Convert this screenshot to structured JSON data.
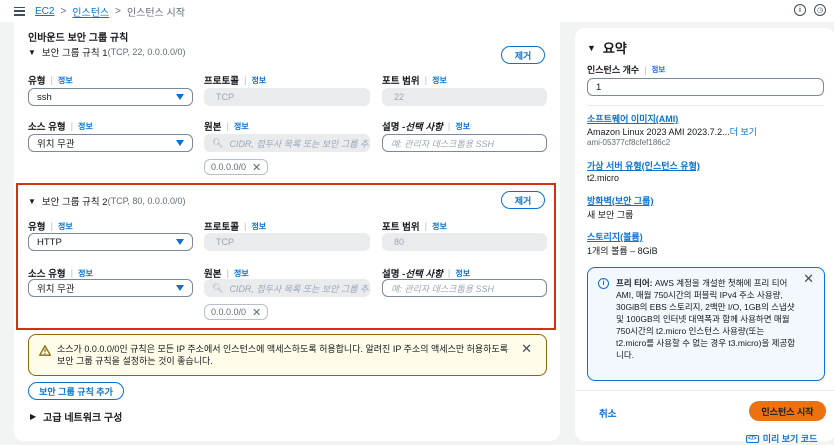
{
  "breadcrumb": {
    "root": "EC2",
    "level2": "인스턴스",
    "current": "인스턴스 시작"
  },
  "inbound": {
    "title": "인바운드 보안 그룹 규칙",
    "rule1": {
      "header": "보안 그룹 규칙 1",
      "detail": "(TCP, 22, 0.0.0.0/0)",
      "remove": "제거",
      "type_label": "유형",
      "type_value": "ssh",
      "protocol_label": "프로토콜",
      "protocol_value": "TCP",
      "port_label": "포트 범위",
      "port_value": "22",
      "source_type_label": "소스 유형",
      "source_type_value": "위치 무관",
      "source_label": "원본",
      "source_placeholder": "CIDR, 접두사 목록 또는 보안 그룹 추가",
      "desc_label": "설명 - ",
      "desc_label_em": "선택 사항",
      "desc_placeholder": "예: 관리자 데스크톱용 SSH",
      "token": "0.0.0.0/0"
    },
    "rule2": {
      "header": "보안 그룹 규칙 2",
      "detail": "(TCP, 80, 0.0.0.0/0)",
      "remove": "제거",
      "type_label": "유형",
      "type_value": "HTTP",
      "protocol_label": "프로토콜",
      "protocol_value": "TCP",
      "port_label": "포트 범위",
      "port_value": "80",
      "source_type_label": "소스 유형",
      "source_type_value": "위치 무관",
      "source_label": "원본",
      "source_placeholder": "CIDR, 접두사 목록 또는 보안 그룹 추가",
      "desc_label": "설명 - ",
      "desc_label_em": "선택 사항",
      "desc_placeholder": "예: 관리자 데스크톱용 SSH",
      "token": "0.0.0.0/0"
    },
    "info_word": "정보",
    "warning": "소스가 0.0.0.0/0인 규칙은 모든 IP 주소에서 인스턴스에 액세스하도록 허용합니다. 알려진 IP 주소의 액세스만 허용하도록 보안 그룹 규칙을 설정하는 것이 좋습니다.",
    "add_rule": "보안 그룹 규칙 추가",
    "advanced": "고급 네트워크 구성"
  },
  "summary": {
    "title": "요약",
    "count_label": "인스턴스 개수",
    "count_value": "1",
    "ami_label": "소프트웨어 이미지(AMI)",
    "ami_value": "Amazon Linux 2023 AMI 2023.7.2...",
    "ami_more": "더 보기",
    "ami_id": "ami-05377cf8cfef186c2",
    "type_label": "가상 서버 유형(인스턴스 유형)",
    "type_value": "t2.micro",
    "fw_label": "방화벽(보안 그룹)",
    "fw_value": "새 보안 그룹",
    "storage_label": "스토리지(볼륨)",
    "storage_value": "1개의 볼륨 – 8GiB",
    "free_tier_bold": "프리 티어:",
    "free_tier_text": " AWS 계정을 개설한 첫해에 프리 티어 AMI, 매월 750시간의 퍼블릭 IPv4 주소 사용량, 30GiB의 EBS 스토리지, 2백만 I/O, 1GB의 스냅샷 및 100GB의 인터넷 대역폭과 함께 사용하면 매월 750시간의 t2.micro 인스턴스 사용량(또는 t2.micro를 사용할 수 없는 경우 t3.micro)을 제공합니다.",
    "cancel": "취소",
    "launch": "인스턴스 시작",
    "preview": "미리 보기 코드"
  }
}
